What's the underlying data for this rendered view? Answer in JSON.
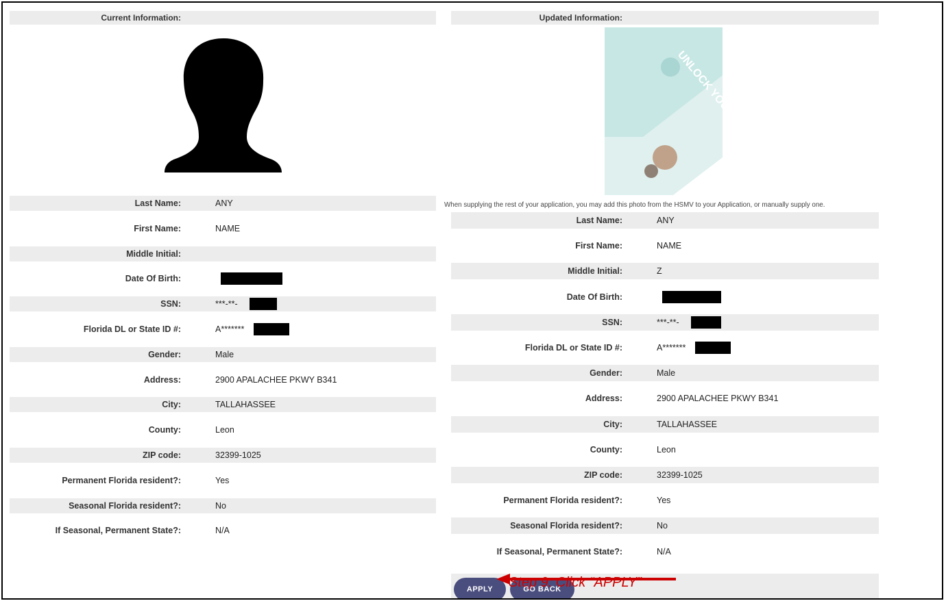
{
  "current": {
    "heading": "Current Information:",
    "fields": [
      {
        "label": "Last Name:",
        "value": "ANY",
        "shade": true
      },
      {
        "label": "First Name:",
        "value": "NAME",
        "shade": false
      },
      {
        "label": "Middle Initial:",
        "value": "",
        "shade": true
      },
      {
        "label": "Date Of Birth:",
        "value": "",
        "redact": 90,
        "shade": false
      },
      {
        "label": "SSN:",
        "value": "***-**-",
        "redact": 40,
        "shade": true
      },
      {
        "label": "Florida DL or State ID #:",
        "value": "A*******",
        "redact": 52,
        "shade": false
      },
      {
        "label": "Gender:",
        "value": "Male",
        "shade": true
      },
      {
        "label": "Address:",
        "value": "2900 APALACHEE PKWY B341",
        "shade": false
      },
      {
        "label": "City:",
        "value": "TALLAHASSEE",
        "shade": true
      },
      {
        "label": "County:",
        "value": "Leon",
        "shade": false
      },
      {
        "label": "ZIP code:",
        "value": "32399-1025",
        "shade": true
      },
      {
        "label": "Permanent Florida resident?:",
        "value": "Yes",
        "shade": false
      },
      {
        "label": "Seasonal Florida resident?:",
        "value": "No",
        "shade": true
      },
      {
        "label": "If Seasonal, Permanent State?:",
        "value": "N/A",
        "shade": false
      }
    ]
  },
  "updated": {
    "heading": "Updated Information:",
    "photo_note": "When supplying the rest of your application, you may add this photo from the HSMV to your Application, or manually supply one.",
    "fields": [
      {
        "label": "Last Name:",
        "value": "ANY",
        "shade": true
      },
      {
        "label": "First Name:",
        "value": "NAME",
        "shade": false
      },
      {
        "label": "Middle Initial:",
        "value": "Z",
        "shade": true
      },
      {
        "label": "Date Of Birth:",
        "value": "",
        "redact": 86,
        "shade": false
      },
      {
        "label": "SSN:",
        "value": "***-**-",
        "redact": 44,
        "shade": true
      },
      {
        "label": "Florida DL or State ID #:",
        "value": "A*******",
        "redact": 52,
        "shade": false
      },
      {
        "label": "Gender:",
        "value": "Male",
        "shade": true
      },
      {
        "label": "Address:",
        "value": "2900 APALACHEE PKWY B341",
        "shade": false
      },
      {
        "label": "City:",
        "value": "TALLAHASSEE",
        "shade": true
      },
      {
        "label": "County:",
        "value": "Leon",
        "shade": false
      },
      {
        "label": "ZIP code:",
        "value": "32399-1025",
        "shade": true
      },
      {
        "label": "Permanent Florida resident?:",
        "value": "Yes",
        "shade": false
      },
      {
        "label": "Seasonal Florida resident?:",
        "value": "No",
        "shade": true
      },
      {
        "label": "If Seasonal, Permanent State?:",
        "value": "N/A",
        "shade": false
      }
    ],
    "photo_text": "UNLOCK YOUR POTENTIAL"
  },
  "buttons": {
    "apply": "APPLY",
    "goback": "GO BACK"
  },
  "callout": "Step 9: Click “APPLY”",
  "colors": {
    "shade": "#ececec",
    "button": "#4a4e7e",
    "callout": "#cc0000"
  }
}
